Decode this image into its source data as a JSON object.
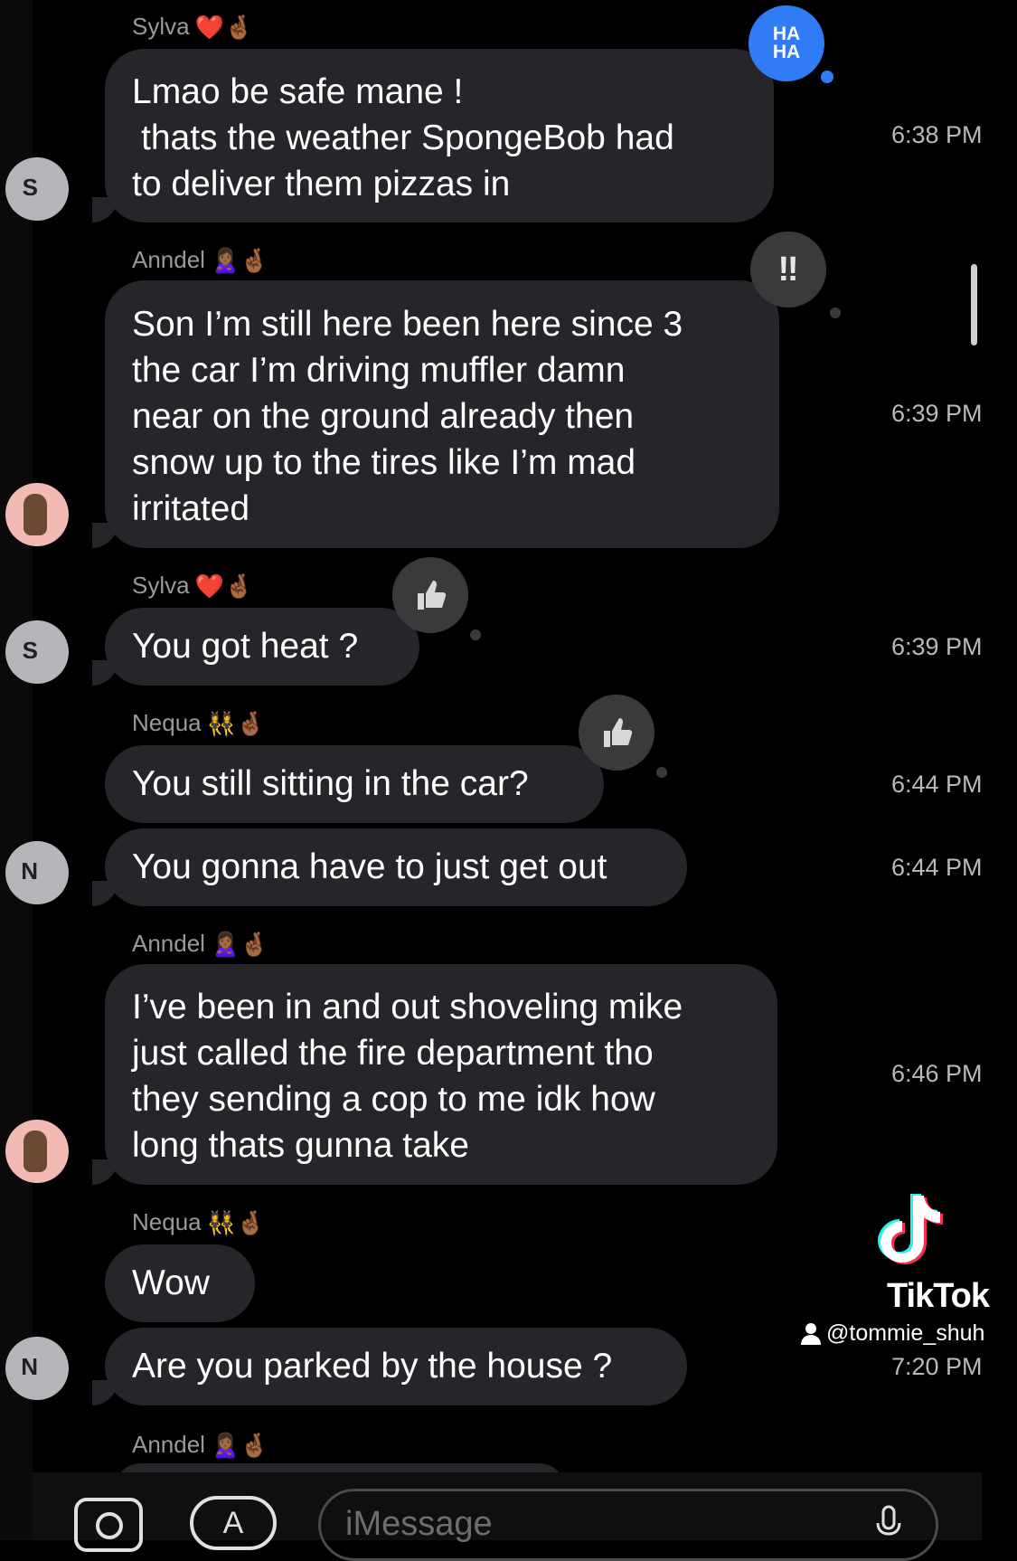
{
  "thread": {
    "messages": [
      {
        "sender": "Sylva",
        "sender_emoji": "❤️🤞🏾",
        "lines": [
          "Lmao be safe mane !",
          "thats the weather SpongeBob had",
          "to deliver them pizzas in"
        ],
        "time": "6:38 PM",
        "tapback": "HA HA"
      },
      {
        "sender": "Anndel",
        "sender_emoji": "🙎🏾‍♀️🤞🏾",
        "lines": [
          "Son I’m still here been here since 3",
          "the car I’m driving muffler damn",
          "near on the ground already then",
          "snow up to the tires like I’m mad",
          "irritated"
        ],
        "time": "6:39 PM",
        "tapback": "‼"
      },
      {
        "sender": "Sylva",
        "sender_emoji": "❤️🤞🏾",
        "lines": [
          "You got heat ?"
        ],
        "time": "6:39 PM",
        "tapback": "thumbs-up-icon"
      },
      {
        "sender": "Nequa",
        "sender_emoji": "👯‍♀️🤞🏾",
        "lines": [
          "You still sitting in the car?"
        ],
        "time": "6:44 PM",
        "tapback": "thumbs-up-icon"
      },
      {
        "sender": "",
        "sender_emoji": "",
        "lines": [
          "You gonna have to just get out"
        ],
        "time": "6:44 PM"
      },
      {
        "sender": "Anndel",
        "sender_emoji": "🙎🏾‍♀️🤞🏾",
        "lines": [
          "I’ve been in and out shoveling mike",
          "just called the fire department tho",
          "they sending a cop to me idk how",
          "long thats gunna take"
        ],
        "time": "6:46 PM"
      },
      {
        "sender": "Nequa",
        "sender_emoji": "👯‍♀️🤞🏾",
        "lines": [
          "Wow"
        ],
        "time": "7:20 PM"
      },
      {
        "sender": "",
        "sender_emoji": "",
        "lines": [
          "Are you parked by the house ?"
        ],
        "time": "7:20 PM"
      },
      {
        "sender": "Anndel",
        "sender_emoji": "🙎🏾‍♀️🤞🏾",
        "lines": [],
        "time": ""
      }
    ]
  },
  "watermark": {
    "brand": "TikTok",
    "handle": "@tommie_shuh"
  },
  "composer": {
    "placeholder": "iMessage"
  },
  "avatars": {
    "s_initial": "S",
    "n_initial": "N"
  },
  "colors": {
    "bubble": "#26262a",
    "background": "#000000",
    "tapback_haha": "#2f7cf6",
    "tapback_gray": "#3a3a3c"
  }
}
